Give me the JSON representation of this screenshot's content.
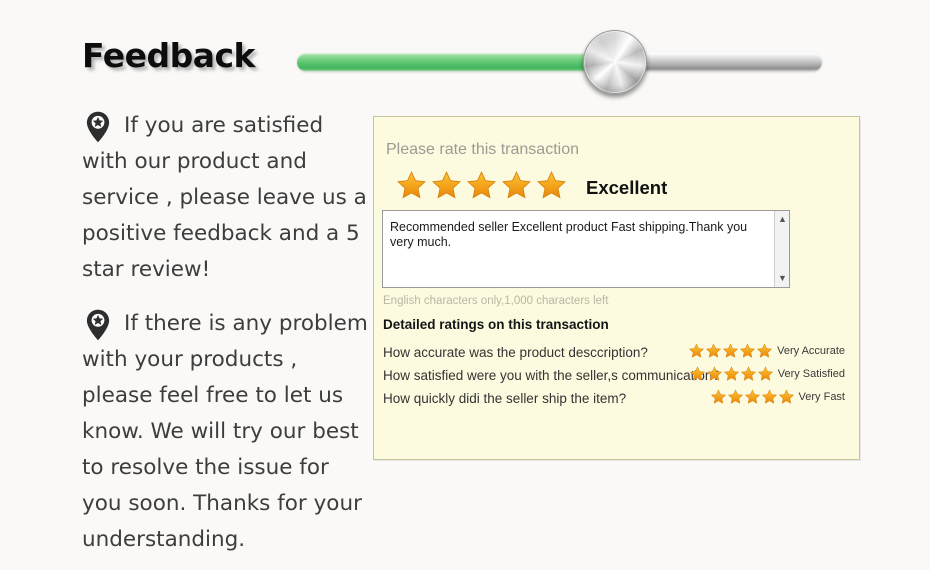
{
  "header": {
    "title": "Feedback",
    "slider": {
      "fill_percent": 61,
      "icon": "slider-knob-icon"
    }
  },
  "left_column": {
    "items": [
      {
        "icon": "map-pin-star-icon",
        "text": "If you are satisfied with our product and service , please leave us a positive feedback and a 5 star review!"
      },
      {
        "icon": "map-pin-star-icon",
        "text": "If there is any problem with your products , please feel free to let us know. We will try our best to resolve the issue for you soon. Thanks for your understanding."
      }
    ]
  },
  "feedback_card": {
    "rate_prompt": "Please rate this transaction",
    "overall_stars": 5,
    "verdict": "Excellent",
    "comment": {
      "value": "Recommended seller Excellent product Fast shipping.Thank you very much.",
      "placeholder": "",
      "scroll_up_icon": "chevron-up-icon",
      "scroll_down_icon": "chevron-down-icon"
    },
    "char_hint": "English characters only,1,000 characters left",
    "detailed_heading": "Detailed ratings on this transaction",
    "detailed_ratings": [
      {
        "question": "How accurate was the product desccription?",
        "stars": 5,
        "label": "Very Accurate"
      },
      {
        "question": "How satisfied were you with the seller,s communication?",
        "stars": 5,
        "label": "Very Satisfied"
      },
      {
        "question": "How quickly didi the seller ship the item?",
        "stars": 5,
        "label": "Very Fast"
      }
    ]
  },
  "colors": {
    "page_background": "#faf9f7",
    "card_background": "#fdfbdf",
    "card_border": "#c9c49a",
    "star_gold": "#f5a623",
    "slider_green": "#53c06a",
    "text_dark": "#3d3d3d",
    "muted_text": "#9b9b93"
  }
}
